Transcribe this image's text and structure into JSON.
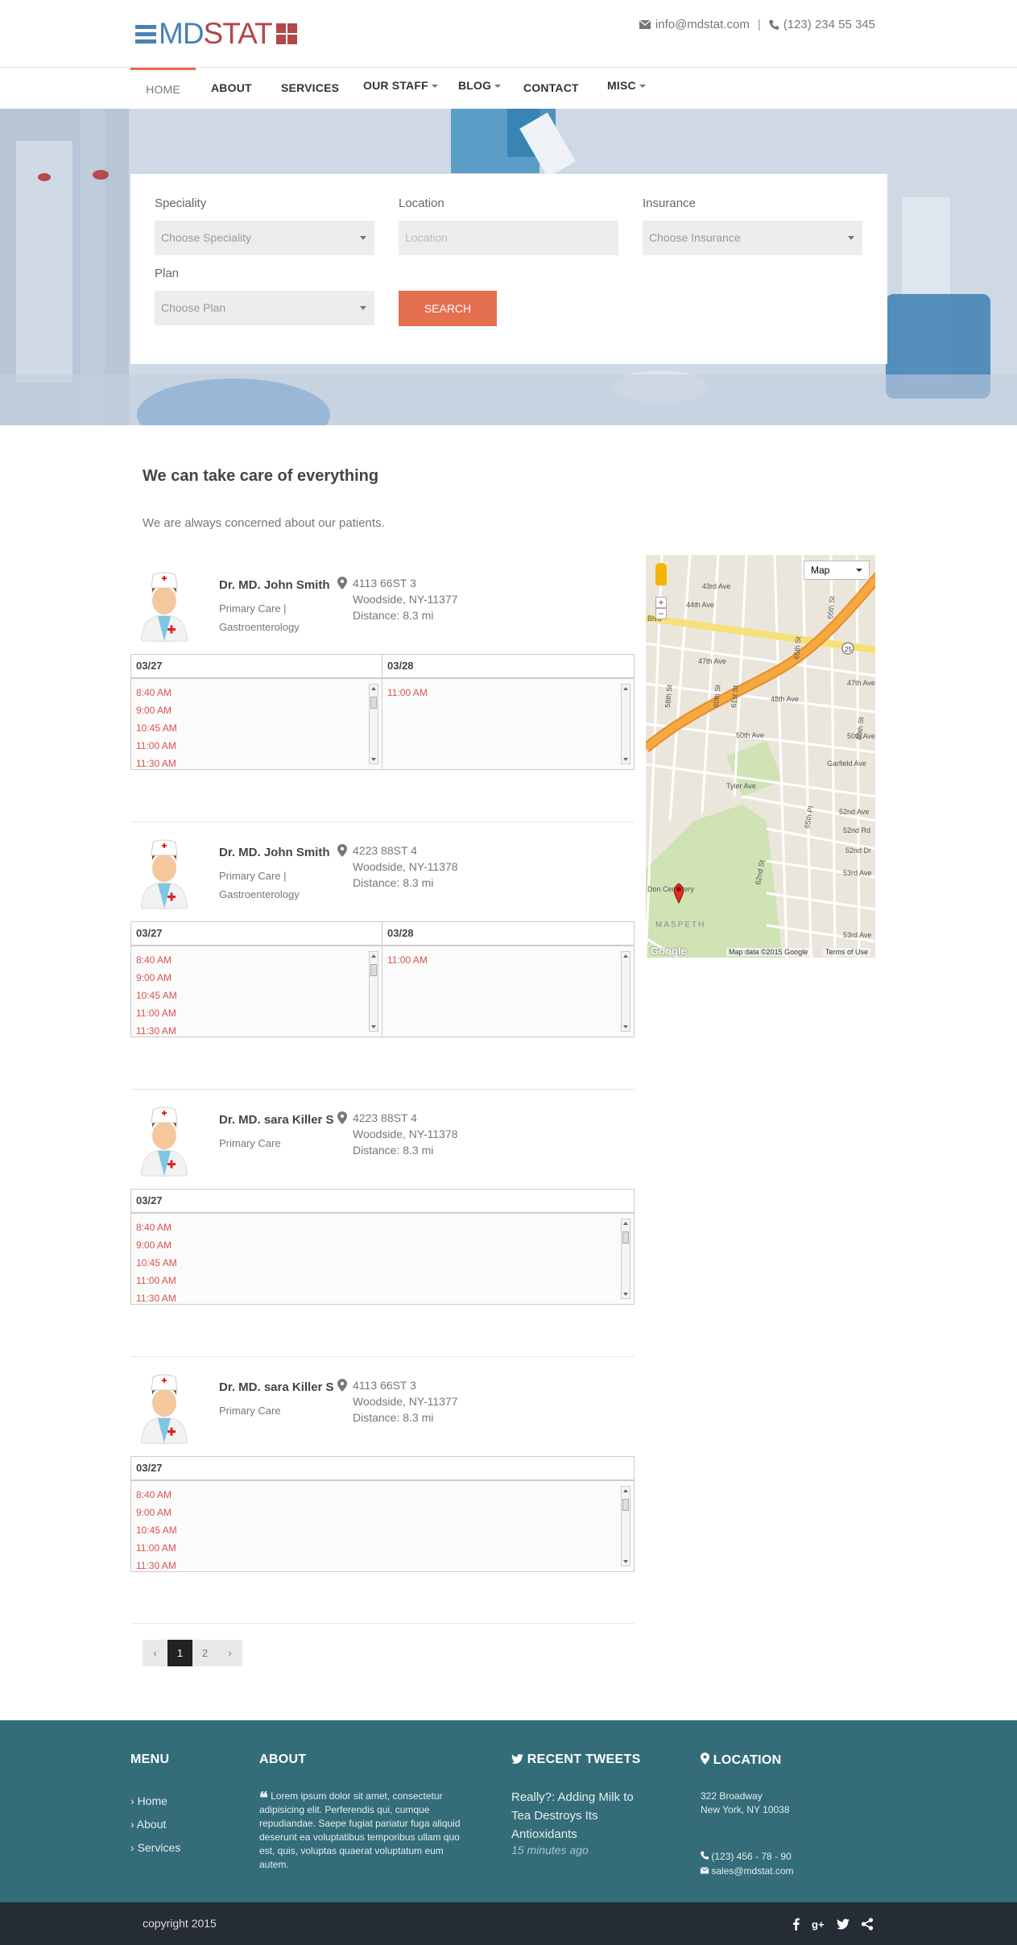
{
  "brand": {
    "logo_part1": "MD",
    "logo_part2": "STAT"
  },
  "contact": {
    "email": "info@mdstat.com",
    "separator": "|",
    "phone": "(123) 234 55 345"
  },
  "nav": {
    "home": "HOME",
    "about": "ABOUT",
    "services": "SERVICES",
    "our_staff": "OUR STAFF",
    "blog": "BLOG",
    "contact": "CONTACT",
    "misc": "MISC"
  },
  "search": {
    "speciality_label": "Speciality",
    "speciality_value": "Choose Speciality",
    "location_label": "Location",
    "location_placeholder": "Location",
    "insurance_label": "Insurance",
    "insurance_value": "Choose Insurance",
    "plan_label": "Plan",
    "plan_value": "Choose Plan",
    "button": "SEARCH"
  },
  "intro": {
    "title": "We can take care of everything",
    "subtitle": "We are always concerned about our patients."
  },
  "doctors": [
    {
      "name": "Dr. MD. John Smith",
      "spec_line1": "Primary Care |",
      "spec_line2": "Gastroenterology",
      "addr1": "4113 66ST 3",
      "addr2": "Woodside, NY-11377",
      "distance": "Distance: 8.3 mi",
      "date1": "03/27",
      "date2": "03/28",
      "slots1": [
        "8:40 AM",
        "9:00 AM",
        "10:45 AM",
        "11:00 AM",
        "11:30 AM"
      ],
      "slots2": [
        "11:00 AM"
      ]
    },
    {
      "name": "Dr. MD. John Smith",
      "spec_line1": "Primary Care |",
      "spec_line2": "Gastroenterology",
      "addr1": "4223 88ST 4",
      "addr2": "Woodside, NY-11378",
      "distance": "Distance: 8.3 mi",
      "date1": "03/27",
      "date2": "03/28",
      "slots1": [
        "8:40 AM",
        "9:00 AM",
        "10:45 AM",
        "11:00 AM",
        "11:30 AM"
      ],
      "slots2": [
        "11:00 AM"
      ]
    },
    {
      "name": "Dr. MD. sara Killer S",
      "spec_line1": "Primary Care",
      "spec_line2": "",
      "addr1": "4223 88ST 4",
      "addr2": "Woodside, NY-11378",
      "distance": "Distance: 8.3 mi",
      "date1": "03/27",
      "slots1": [
        "8:40 AM",
        "9:00 AM",
        "10:45 AM",
        "11:00 AM",
        "11:30 AM"
      ]
    },
    {
      "name": "Dr. MD. sara Killer S",
      "spec_line1": "Primary Care",
      "spec_line2": "",
      "addr1": "4113 66ST 3",
      "addr2": "Woodside, NY-11377",
      "distance": "Distance: 8.3 mi",
      "date1": "03/27",
      "slots1": [
        "8:40 AM",
        "9:00 AM",
        "10:45 AM",
        "11:00 AM",
        "11:30 AM"
      ]
    }
  ],
  "map": {
    "type_select": "Map",
    "attribution": "Map data ©2015 Google",
    "terms": "Terms of Use",
    "labels": {
      "blvd": "Blvd",
      "ave44": "44th Ave",
      "ave47": "47th Ave",
      "ave48": "48th Ave",
      "ave50": "50th Ave",
      "ave47b": "47th Ave",
      "ave50b": "50th Ave",
      "garfield": "Garfield Ave",
      "tyler": "Tyler Ave",
      "pl65": "65th Pl",
      "rd52": "52nd Rd",
      "ave52": "52nd Ave",
      "dr52": "52nd Dr",
      "ave53": "53rd Ave",
      "ave53b": "53rd Ave",
      "cemetery": "Don Cemetery",
      "maspeth": "MASPETH",
      "st62": "62nd St",
      "st58": "58th St",
      "st60": "60th St",
      "st61": "61st St",
      "st65": "65th St",
      "st66": "66th St",
      "st69": "69th St",
      "ave43": "43rd Ave",
      "rt25": "25",
      "google": "Google"
    }
  },
  "pagination": {
    "prev": "‹",
    "p1": "1",
    "p2": "2",
    "next": "›"
  },
  "footer": {
    "menu_title": "MENU",
    "menu_items": [
      "Home",
      "About",
      "Services"
    ],
    "about_title": "ABOUT",
    "about_text": "Lorem ipsum dolor sit amet, consectetur adipisicing elit. Perferendis qui, cumque repudiandae. Saepe fugiat pariatur fuga aliquid deserunt ea voluptatibus temporibus ullam quo est, quis, voluptas quaerat voluptatum eum autem.",
    "tweets_title": "RECENT TWEETS",
    "tweet_text": "Really?: Adding Milk to Tea Destroys Its Antioxidants",
    "tweet_time": "15 minutes ago",
    "location_title": "LOCATION",
    "addr1": "322 Broadway",
    "addr2": "New York, NY 10038",
    "phone": "(123) 456 - 78 - 90",
    "email": "sales@mdstat.com"
  },
  "copyright": "copyright 2015",
  "colors": {
    "accent": "#e4704f",
    "brand_blue": "#4a80b8",
    "brand_red": "#b0494b",
    "footer": "#346d79",
    "bottom_bar": "#252c36",
    "slot_red": "#d9534f"
  }
}
